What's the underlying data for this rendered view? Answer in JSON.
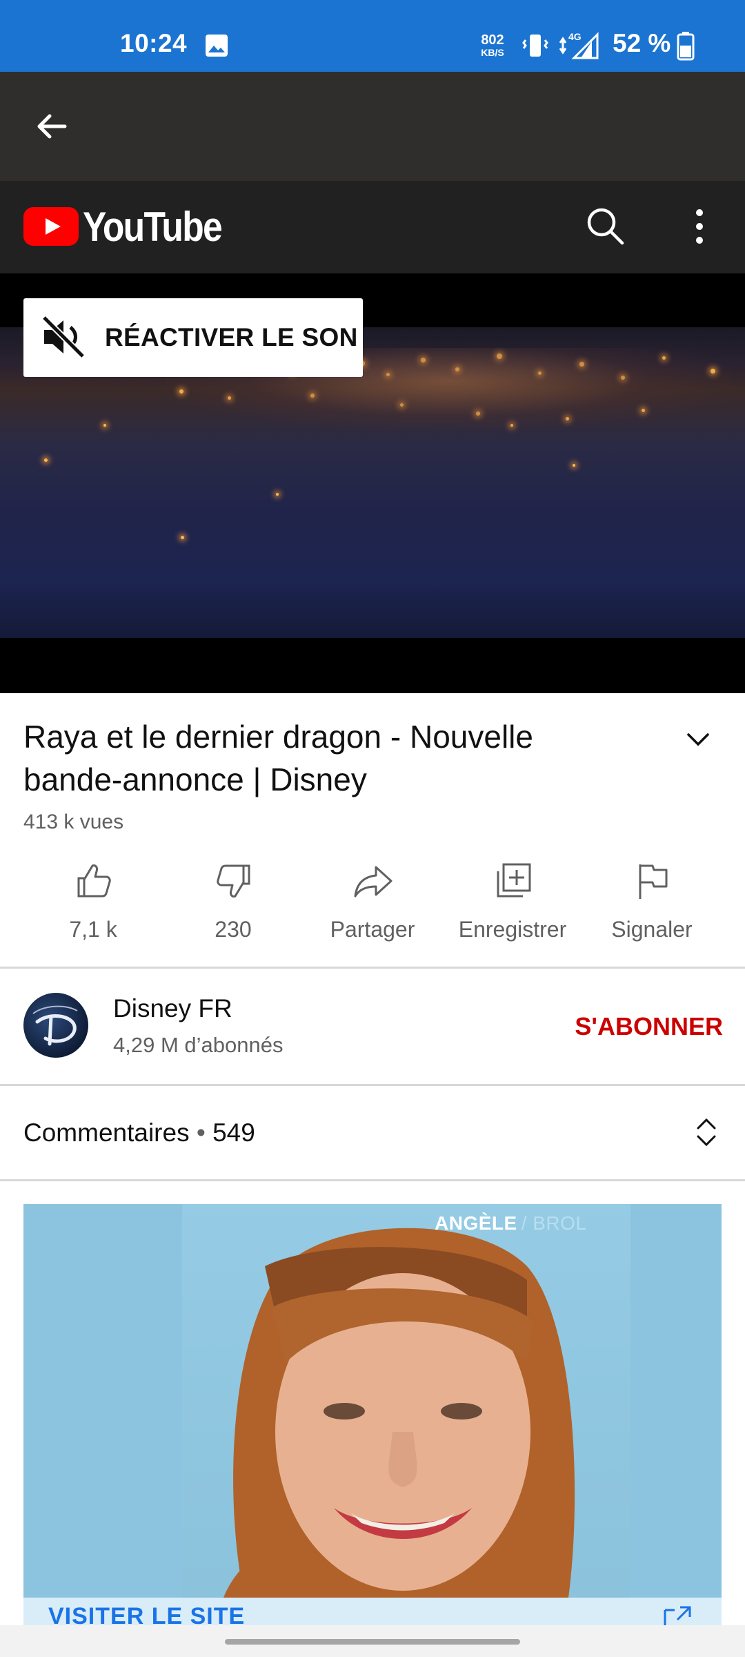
{
  "status_bar": {
    "time": "10:24",
    "speed_value": "802",
    "speed_unit": "KB/S",
    "network": "4G",
    "battery": "52 %"
  },
  "header": {
    "brand": "YouTube"
  },
  "video": {
    "unmute_label": "RÉACTIVER LE SON"
  },
  "info": {
    "title": "Raya et le dernier dragon - Nouvelle bande-annonce | Disney",
    "views": "413 k vues"
  },
  "actions": [
    {
      "label": "7,1 k",
      "icon": "thumbs-up-icon"
    },
    {
      "label": "230",
      "icon": "thumbs-down-icon"
    },
    {
      "label": "Partager",
      "icon": "share-icon"
    },
    {
      "label": "Enregistrer",
      "icon": "add-to-playlist-icon"
    },
    {
      "label": "Signaler",
      "icon": "flag-icon"
    }
  ],
  "channel": {
    "name": "Disney FR",
    "subscribers": "4,29 M d’abonnés",
    "subscribe_label": "S'ABONNER"
  },
  "comments": {
    "label": "Commentaires",
    "separator": "•",
    "count": "549"
  },
  "ad": {
    "brand": "ANGÈLE",
    "brand_sub": "/ BROL",
    "cta": "VISITER LE SITE"
  },
  "colors": {
    "status_bar": "#1b74d1",
    "youtube_red": "#ff0000",
    "subscribe": "#cc0000",
    "link_blue": "#1a73e8"
  }
}
